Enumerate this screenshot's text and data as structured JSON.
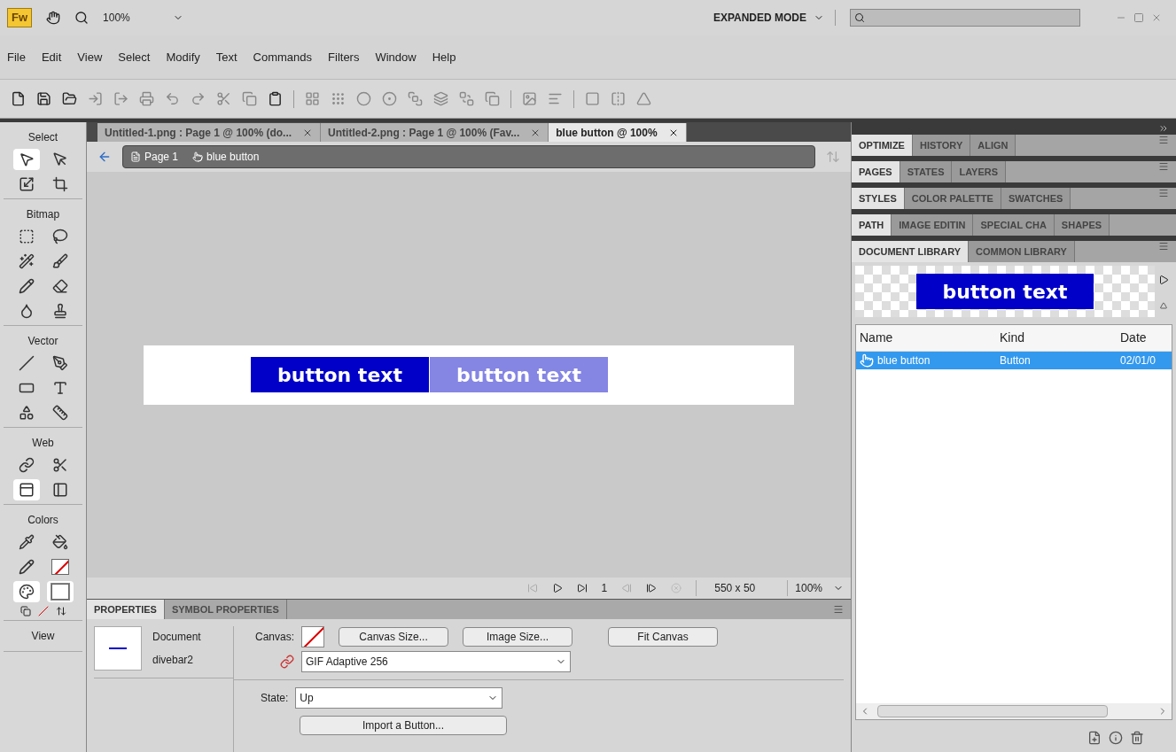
{
  "app_bar": {
    "logo": "Fw",
    "zoom": "100%",
    "mode": "EXPANDED MODE"
  },
  "menu": [
    "File",
    "Edit",
    "View",
    "Select",
    "Modify",
    "Text",
    "Commands",
    "Filters",
    "Window",
    "Help"
  ],
  "document_tabs": [
    {
      "label": "Untitled-1.png : Page 1 @ 100% (do...",
      "selected": false
    },
    {
      "label": "Untitled-2.png : Page 1 @ 100% (Fav...",
      "selected": false
    },
    {
      "label": "blue button @ 100%",
      "selected": true
    }
  ],
  "breadcrumb": [
    "Page 1",
    "blue button"
  ],
  "canvas": {
    "buttons": [
      {
        "label": "button text",
        "kind": "up"
      },
      {
        "label": "button text",
        "kind": "over"
      }
    ]
  },
  "status_bar": {
    "frame": "1",
    "size": "550 x 50",
    "zoom": "100%"
  },
  "tools": [
    {
      "title": "Select",
      "items": [
        {
          "selected": true
        },
        {
          "selected": false
        },
        {
          "selected": false
        },
        {
          "selected": false
        }
      ]
    },
    {
      "title": "Bitmap",
      "items": [
        {
          "selected": false
        },
        {
          "selected": false
        },
        {
          "selected": false
        },
        {
          "selected": false
        },
        {
          "selected": false
        },
        {
          "selected": false
        },
        {
          "selected": false
        },
        {
          "selected": false
        }
      ]
    },
    {
      "title": "Vector",
      "items": [
        {
          "selected": false
        },
        {
          "selected": false
        },
        {
          "selected": false
        },
        {
          "selected": false
        },
        {
          "selected": false
        },
        {
          "selected": false
        }
      ]
    },
    {
      "title": "Web",
      "items": [
        {
          "selected": false
        },
        {
          "selected": false
        },
        {
          "selected": true
        },
        {
          "selected": false
        }
      ]
    },
    {
      "title": "Colors",
      "items": [
        {
          "selected": false
        },
        {
          "selected": false
        },
        {
          "selected": false
        },
        {
          "selected": false
        },
        {
          "selected": true
        },
        {
          "selected": true
        }
      ]
    },
    {
      "title": "View"
    }
  ],
  "properties": {
    "tabs": [
      {
        "label": "PROPERTIES",
        "selected": true
      },
      {
        "label": "SYMBOL PROPERTIES",
        "selected": false
      }
    ],
    "doc_type": "Document",
    "doc_name": "divebar2",
    "canvas_label": "Canvas:",
    "buttons": [
      "Canvas Size...",
      "Image Size...",
      "Fit Canvas"
    ],
    "export_format": "GIF Adaptive 256",
    "state_label": "State:",
    "state": "Up",
    "import_button": "Import a Button..."
  },
  "panels": [
    {
      "tabs": [
        {
          "label": "OPTIMIZE",
          "selected": true
        },
        {
          "label": "HISTORY",
          "selected": false
        },
        {
          "label": "ALIGN",
          "selected": false
        }
      ]
    },
    {
      "tabs": [
        {
          "label": "PAGES",
          "selected": true
        },
        {
          "label": "STATES",
          "selected": false
        },
        {
          "label": "LAYERS",
          "selected": false
        }
      ]
    },
    {
      "tabs": [
        {
          "label": "STYLES",
          "selected": true
        },
        {
          "label": "COLOR PALETTE",
          "selected": false
        },
        {
          "label": "SWATCHES",
          "selected": false
        }
      ]
    },
    {
      "tabs": [
        {
          "label": "PATH",
          "selected": true
        },
        {
          "label": "IMAGE EDITIN",
          "selected": false
        },
        {
          "label": "SPECIAL CHA",
          "selected": false
        },
        {
          "label": "SHAPES",
          "selected": false
        }
      ]
    },
    {
      "tabs": [
        {
          "label": "DOCUMENT LIBRARY",
          "selected": true
        },
        {
          "label": "COMMON LIBRARY",
          "selected": false
        }
      ]
    }
  ],
  "library": {
    "preview_text": "button text",
    "columns": [
      "Name",
      "Kind",
      "Date"
    ],
    "rows": [
      {
        "name": "blue button",
        "kind": "Button",
        "date": "02/01/0",
        "selected": true
      }
    ]
  }
}
